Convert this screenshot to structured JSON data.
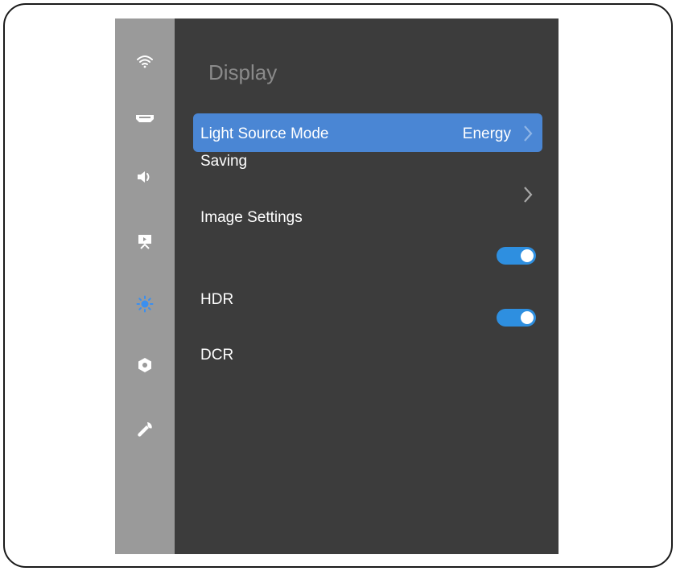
{
  "sidebar": {
    "items": [
      {
        "icon": "wifi-icon"
      },
      {
        "icon": "input-port-icon"
      },
      {
        "icon": "speaker-icon"
      },
      {
        "icon": "projector-screen-icon"
      },
      {
        "icon": "brightness-icon",
        "active": true
      },
      {
        "icon": "settings-hex-icon"
      },
      {
        "icon": "wrench-icon"
      }
    ]
  },
  "main": {
    "title": "Display",
    "rows": [
      {
        "label_line1": "Light Source Mode",
        "label_line2": "Saving",
        "value": "Energy",
        "control": "chevron",
        "selected": true
      },
      {
        "label": "Image Settings",
        "control": "chevron"
      },
      {
        "label": "HDR",
        "control": "toggle",
        "state": "on"
      },
      {
        "label": "DCR",
        "control": "toggle",
        "state": "on"
      }
    ]
  },
  "colors": {
    "screen_bg": "#3c3c3c",
    "sidebar_bg": "#9a9a9a",
    "highlight": "#4a86d4",
    "toggle_on": "#2e8fe0",
    "active_icon": "#3a8ff0"
  }
}
